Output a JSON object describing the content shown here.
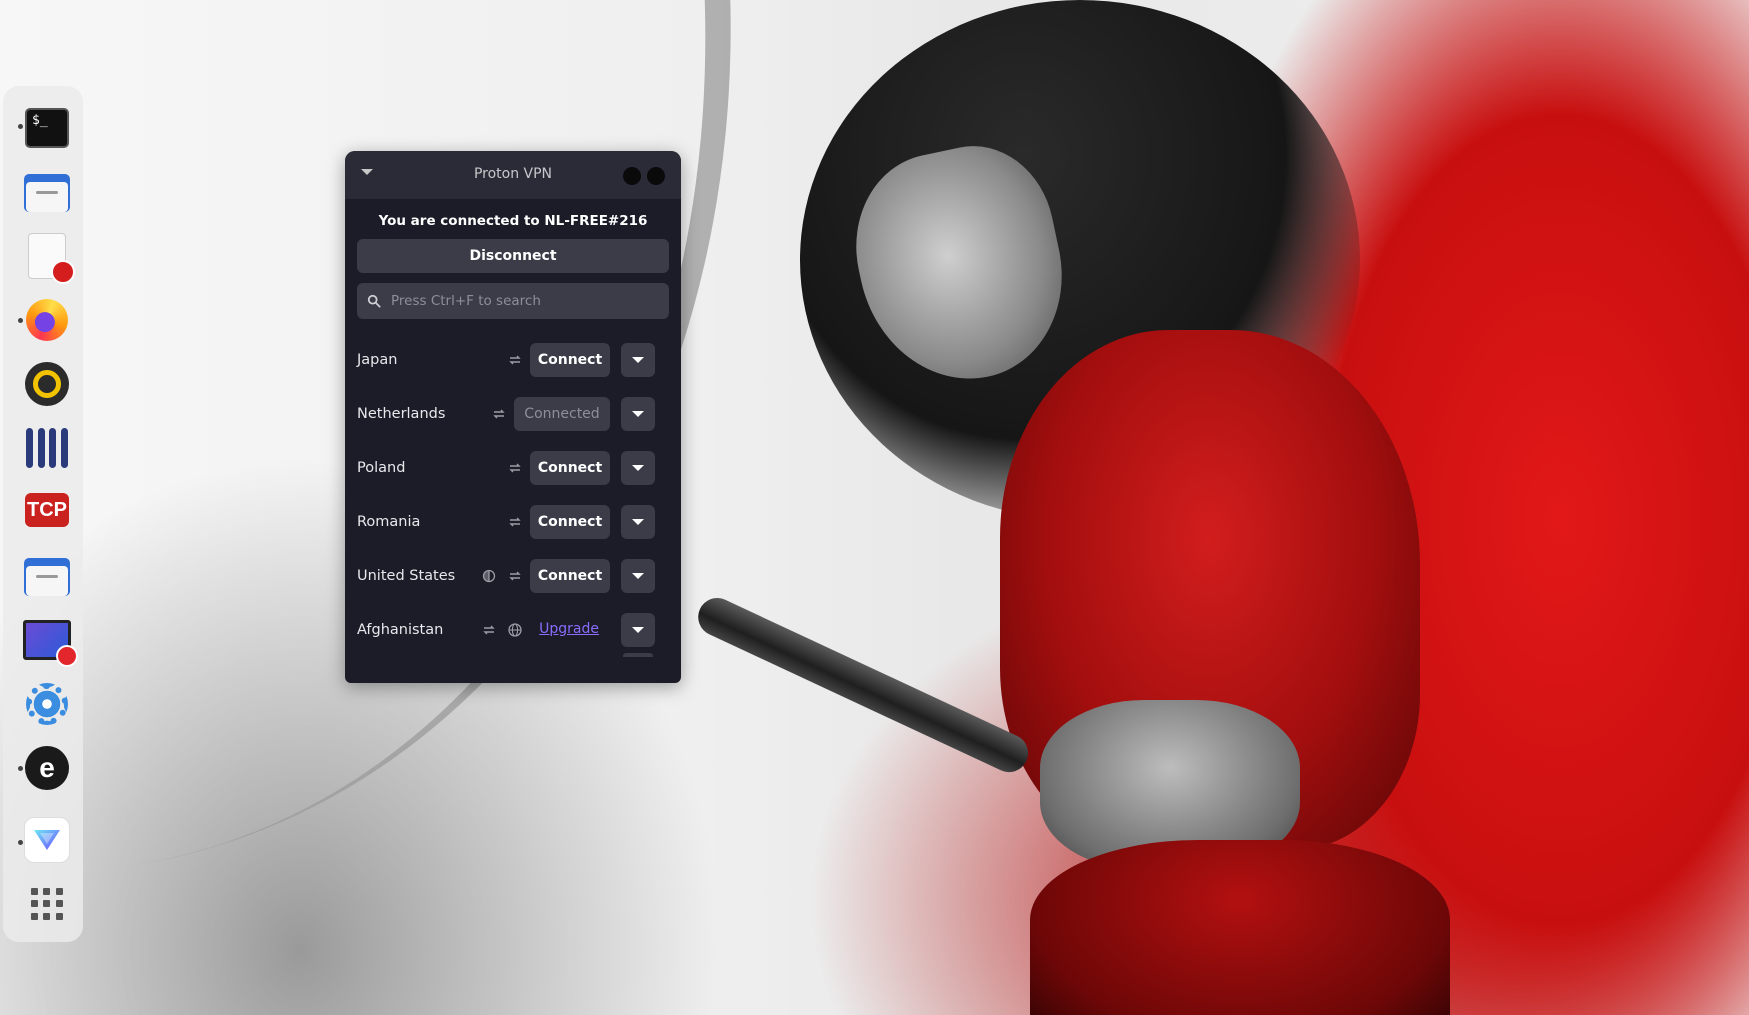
{
  "window": {
    "title": "Proton VPN",
    "status": "You are connected to NL-FREE#216",
    "disconnect_label": "Disconnect",
    "search_placeholder": "Press Ctrl+F to search"
  },
  "countries": [
    {
      "name": "Japan",
      "action": "Connect"
    },
    {
      "name": "Netherlands",
      "action": "Connected"
    },
    {
      "name": "Poland",
      "action": "Connect"
    },
    {
      "name": "Romania",
      "action": "Connect"
    },
    {
      "name": "United States",
      "action": "Connect"
    },
    {
      "name": "Afghanistan",
      "action": "Upgrade"
    }
  ],
  "dock": {
    "terminal_text": "$_",
    "tcp_label": "TCP",
    "e_label": "e",
    "apps": [
      "terminal-icon",
      "files-icon",
      "text-editor-icon",
      "firefox-icon",
      "ring-app-icon",
      "mixer-icon",
      "tcp-app-icon",
      "files-icon",
      "screen-recorder-icon",
      "settings-gear-icon",
      "e-app-icon",
      "proton-vpn-icon",
      "app-grid-icon"
    ]
  },
  "colors": {
    "window_bg": "#1b1c27",
    "titlebar_bg": "#2a2b36",
    "button_bg": "#3b3c48",
    "upgrade_link": "#8a6cff"
  }
}
